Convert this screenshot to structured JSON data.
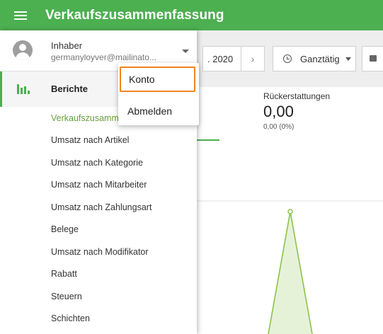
{
  "header": {
    "title": "Verkaufszusammenfassung",
    "menu_icon": "hamburger-menu-icon",
    "color": "#4caf50"
  },
  "toolbar": {
    "date_fragment": ". 2020",
    "next_glyph": "›",
    "time_range": "Ganztätig"
  },
  "stats": {
    "label": "Rückerstattungen",
    "value": "0,00",
    "sub": "0,00 (0%)"
  },
  "drawer": {
    "user": {
      "role": "Inhaber",
      "email": "germanyloyver@mailinato..."
    },
    "section": {
      "label": "Berichte",
      "icon": "bar-chart-icon"
    },
    "items": [
      {
        "label": "Verkaufszusamm",
        "active": true
      },
      {
        "label": "Umsatz nach Artikel"
      },
      {
        "label": "Umsatz nach Kategorie"
      },
      {
        "label": "Umsatz nach Mitarbeiter"
      },
      {
        "label": "Umsatz nach Zahlungsart"
      },
      {
        "label": "Belege"
      },
      {
        "label": "Umsatz nach Modifikator"
      },
      {
        "label": "Rabatt"
      },
      {
        "label": "Steuern"
      },
      {
        "label": "Schichten"
      }
    ]
  },
  "account_menu": {
    "items": [
      "Konto",
      "Abmelden"
    ],
    "highlight_color": "#f0851e"
  }
}
